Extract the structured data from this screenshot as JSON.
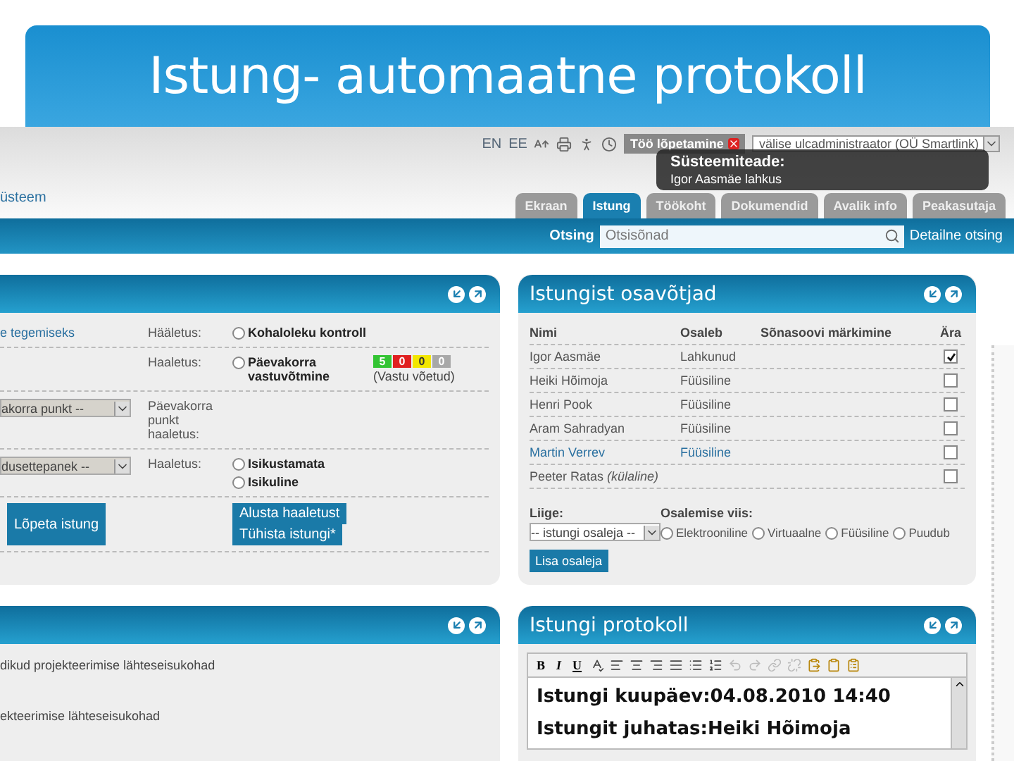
{
  "slide": {
    "title": "Istung- automaatne protokoll"
  },
  "header": {
    "site_name": "üsteem",
    "languages": [
      "EN",
      "EE"
    ],
    "logout_button": "Töö lõpetamine",
    "user_select": "välise ulcadministraator (OÜ Smartlink)"
  },
  "tabs": [
    {
      "label": "Ekraan",
      "selected": false
    },
    {
      "label": "Istung",
      "selected": true
    },
    {
      "label": "Töökoht",
      "selected": false
    },
    {
      "label": "Dokumendid",
      "selected": false
    },
    {
      "label": "Avalik info",
      "selected": false
    },
    {
      "label": "Peakasutaja",
      "selected": false
    }
  ],
  "notification": {
    "title": "Süsteemiteade:",
    "message": "Igor Aasmäe lahkus"
  },
  "search": {
    "label": "Otsing",
    "placeholder": "Otsisõnad",
    "advanced_link": "Detailne otsing"
  },
  "voting_panel": {
    "rows": [
      {
        "kind": "link",
        "left": "e tegemiseks",
        "label": "Hääletus:",
        "options": [
          {
            "label": "Kohaloleku kontroll",
            "selected": false
          }
        ]
      },
      {
        "kind": "result",
        "label": "Haaletus:",
        "options": [
          {
            "label": "Päevakorra vastuvõtmine",
            "selected": false
          }
        ],
        "counts": [
          {
            "value": "5",
            "color": "#33c433"
          },
          {
            "value": "0",
            "color": "#e02020"
          },
          {
            "value": "0",
            "color": "#f2e600"
          },
          {
            "value": "0",
            "color": "#a8a8a8"
          }
        ],
        "result": "(Vastu võetud)"
      },
      {
        "kind": "select",
        "left": "akorra punkt --",
        "label": "Päevakorra punkt haaletus:"
      },
      {
        "kind": "select",
        "left": "dusettepanek --",
        "label": "Haaletus:",
        "options": [
          {
            "label": "Isikustamata",
            "selected": false
          },
          {
            "label": "Isikuline",
            "selected": false
          }
        ]
      }
    ],
    "end_button": "Lõpeta istung",
    "vote_buttons": [
      "Alusta haaletust",
      "Tühista istungi*"
    ]
  },
  "documents_panel": {
    "lines": [
      "dikud projekteerimise lähteseisukohad",
      "ekteerimise lähteseisukohad"
    ]
  },
  "participants_panel": {
    "title": "Istungist osavõtjad",
    "columns": [
      "Nimi",
      "Osaleb",
      "Sõnasoovi märkimine",
      "Ära"
    ],
    "rows": [
      {
        "name": "Igor Aasmäe",
        "status": "Lahkunud",
        "linked": false,
        "away": true
      },
      {
        "name": "Heiki Hõimoja",
        "status": "Füüsiline",
        "linked": false,
        "away": false
      },
      {
        "name": "Henri Pook",
        "status": "Füüsiline",
        "linked": false,
        "away": false
      },
      {
        "name": "Aram Sahradyan",
        "status": "Füüsiline",
        "linked": false,
        "away": false
      },
      {
        "name": "Martin Verrev",
        "status": "Füüsiline",
        "linked": true,
        "away": false
      },
      {
        "name": "Peeter Ratas *(külaline)*",
        "linked": false,
        "away": false
      }
    ],
    "member_label": "Liige:",
    "member_select": "-- istungi osaleja --",
    "mode_label": "Osalemise viis:",
    "modes": [
      {
        "label": "Elektrooniline",
        "selected": false
      },
      {
        "label": "Virtuaalne",
        "selected": false
      },
      {
        "label": "Füüsiline",
        "selected": false
      },
      {
        "label": "Puudub",
        "selected": false
      }
    ],
    "add_button": "Lisa osaleja"
  },
  "protocol_panel": {
    "title": "Istungi protokoll",
    "format_buttons": [
      "B",
      "I",
      "U"
    ],
    "lines": [
      "Istungi kuupäev:04.08.2010 14:40",
      "Istungit juhatas:Heiki Hõimoja"
    ]
  }
}
